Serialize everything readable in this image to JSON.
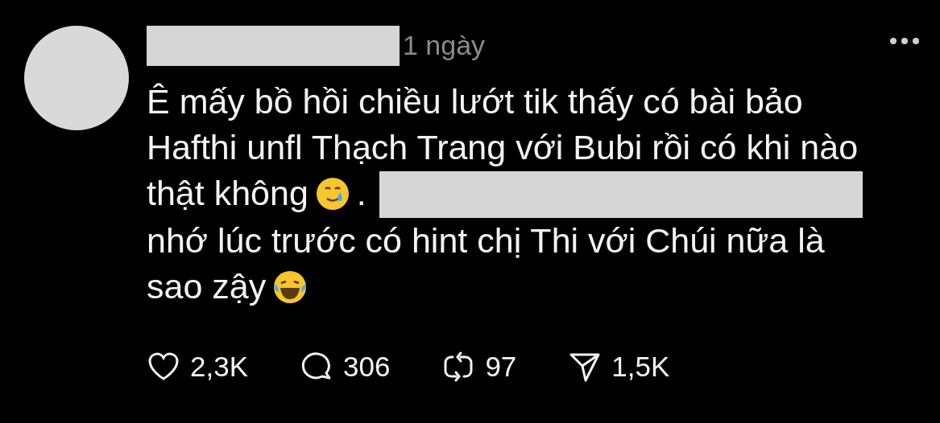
{
  "post": {
    "time": "1 ngày",
    "body": [
      {
        "kind": "text",
        "text": "Ê mấy bồ hồi chiều lướt tik thấy có bài bảo\nHafthi unfl Thạch Trang với Bubi rồi có khi nào\nthật không"
      },
      {
        "kind": "smiling-tear-emoji"
      },
      {
        "kind": "text",
        "text": "."
      },
      {
        "kind": "redacted"
      },
      {
        "kind": "break"
      },
      {
        "kind": "text",
        "text": "nhớ lúc trước có hint chị Thi với Chúi nữa là\nsao zậy"
      },
      {
        "kind": "laughing-emoji"
      }
    ],
    "actions": [
      {
        "kind": "like",
        "count": "2,3K"
      },
      {
        "kind": "reply",
        "count": "306"
      },
      {
        "kind": "repost",
        "count": "97"
      },
      {
        "kind": "share",
        "count": "1,5K"
      }
    ]
  }
}
